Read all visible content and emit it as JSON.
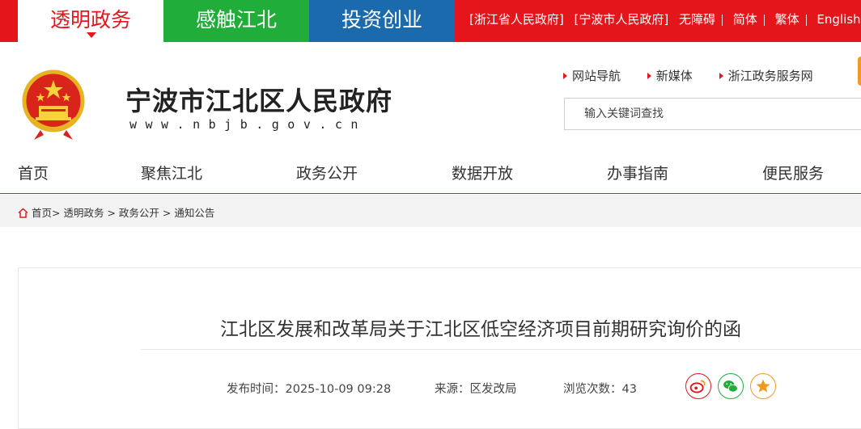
{
  "topbar": {
    "tabs": [
      "透明政务",
      "感触江北",
      "投资创业"
    ],
    "links": [
      "[浙江省人民政府]",
      "[宁波市人民政府]",
      "无障碍",
      "简体",
      "繁体",
      "English"
    ]
  },
  "header": {
    "site_name": "宁波市江北区人民政府",
    "site_url": "www.nbjb.gov.cn",
    "quick_links": [
      "网站导航",
      "新媒体",
      "浙江政务服务网"
    ],
    "search_placeholder": "输入关键词查找"
  },
  "nav": {
    "items": [
      "首页",
      "聚焦江北",
      "政务公开",
      "数据开放",
      "办事指南",
      "便民服务"
    ]
  },
  "breadcrumb": {
    "items": [
      "首页>",
      "透明政务 >",
      "政务公开 >",
      "通知公告"
    ]
  },
  "article": {
    "title": "江北区发展和改革局关于江北区低空经济项目前期研究询价的函",
    "publish_label": "发布时间：",
    "publish_time": "2025-10-09 09:28",
    "source_label": "来源：",
    "source": "区发改局",
    "views_label": "浏览次数：",
    "views": "43"
  },
  "share": {
    "icons": [
      "weibo-icon",
      "wechat-icon",
      "favorite-star-icon"
    ]
  },
  "colors": {
    "red": "#e4151b",
    "green": "#21ad3a",
    "blue": "#1c6aae",
    "orange": "#f29a1e"
  }
}
